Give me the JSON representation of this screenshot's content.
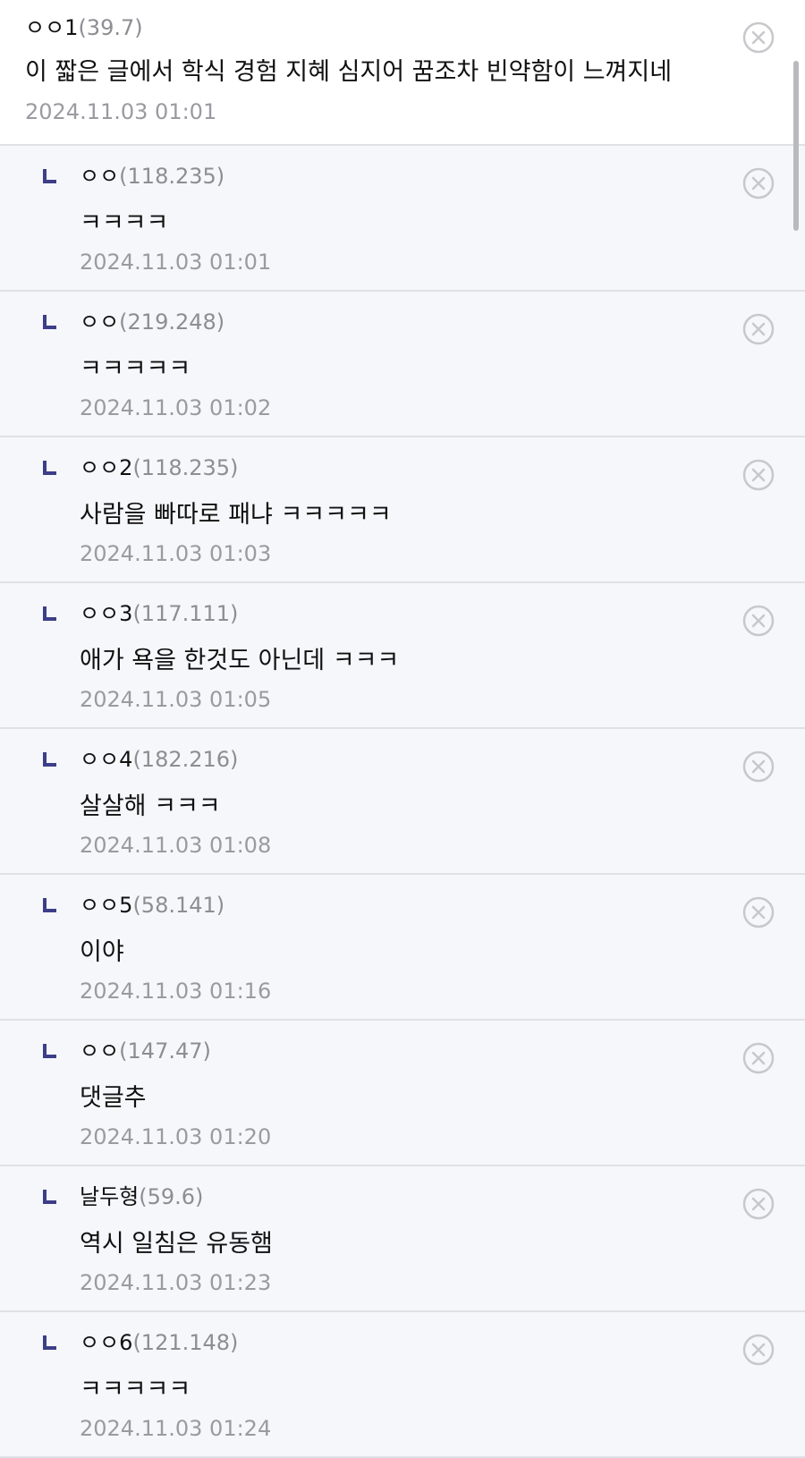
{
  "comments": [
    {
      "nick": "ㅇㅇ1",
      "ip": "(39.7)",
      "text": "이 짧은 글에서 학식 경험 지혜 심지어 꿈조차 빈약함이 느껴지네",
      "time": "2024.11.03 01:01",
      "is_reply": false
    },
    {
      "nick": "ㅇㅇ",
      "ip": "(118.235)",
      "text": "ㅋㅋㅋㅋ",
      "time": "2024.11.03 01:01",
      "is_reply": true
    },
    {
      "nick": "ㅇㅇ",
      "ip": "(219.248)",
      "text": "ㅋㅋㅋㅋㅋ",
      "time": "2024.11.03 01:02",
      "is_reply": true
    },
    {
      "nick": "ㅇㅇ2",
      "ip": "(118.235)",
      "text": "사람을 빠따로 패냐 ㅋㅋㅋㅋㅋ",
      "time": "2024.11.03 01:03",
      "is_reply": true
    },
    {
      "nick": "ㅇㅇ3",
      "ip": "(117.111)",
      "text": "애가 욕을 한것도 아닌데 ㅋㅋㅋ",
      "time": "2024.11.03 01:05",
      "is_reply": true
    },
    {
      "nick": "ㅇㅇ4",
      "ip": "(182.216)",
      "text": "살살해 ㅋㅋㅋ",
      "time": "2024.11.03 01:08",
      "is_reply": true
    },
    {
      "nick": "ㅇㅇ5",
      "ip": "(58.141)",
      "text": "이야",
      "time": "2024.11.03 01:16",
      "is_reply": true
    },
    {
      "nick": "ㅇㅇ",
      "ip": "(147.47)",
      "text": "댓글추",
      "time": "2024.11.03 01:20",
      "is_reply": true
    },
    {
      "nick": "날두형",
      "ip": "(59.6)",
      "text": "역시 일침은 유동햄",
      "time": "2024.11.03 01:23",
      "is_reply": true
    },
    {
      "nick": "ㅇㅇ6",
      "ip": "(121.148)",
      "text": "ㅋㅋㅋㅋㅋ",
      "time": "2024.11.03 01:24",
      "is_reply": true
    }
  ],
  "icons": {
    "reply": "reply-arrow-icon",
    "delete": "close-circle-icon"
  },
  "colors": {
    "reply_marker": "#3c3e88",
    "ip_text": "#8d8d93",
    "timestamp_text": "#9a9aa0",
    "divider": "#dfe1e7",
    "reply_background": "#f6f7fa",
    "top_background": "#ffffff"
  }
}
